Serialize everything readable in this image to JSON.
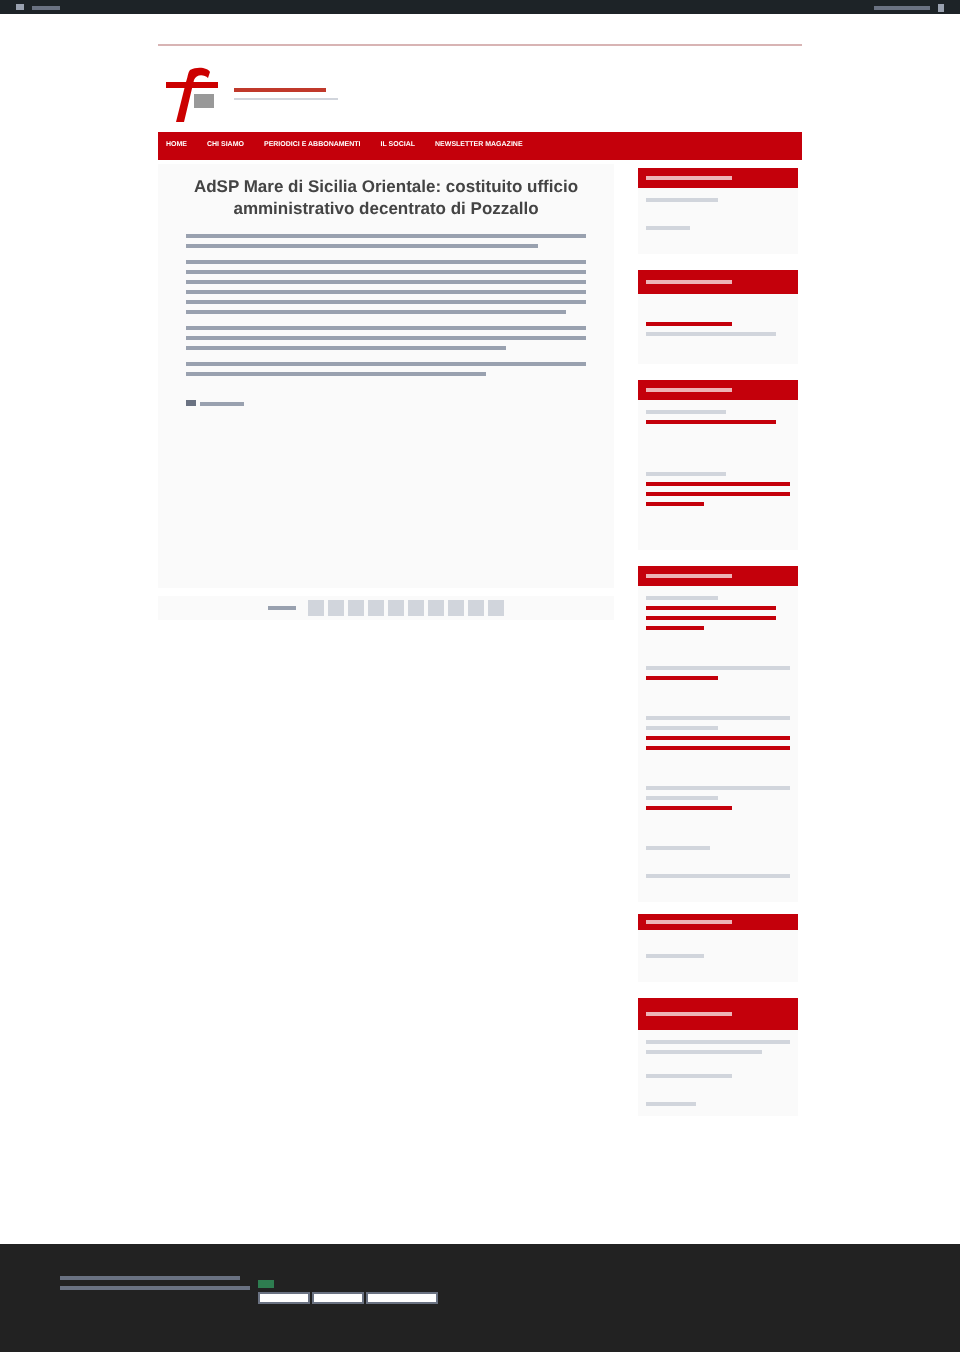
{
  "nav": {
    "items": [
      {
        "label": "HOME"
      },
      {
        "label": "CHI SIAMO"
      },
      {
        "label": "PERIODICI E ABBONAMENTI"
      },
      {
        "label": "IL SOCIAL"
      },
      {
        "label": "NEWSLETTER MAGAZINE"
      }
    ]
  },
  "article": {
    "title": "AdSP Mare di Sicilia Orientale: costituito ufficio amministrativo decentrato di Pozzallo"
  }
}
